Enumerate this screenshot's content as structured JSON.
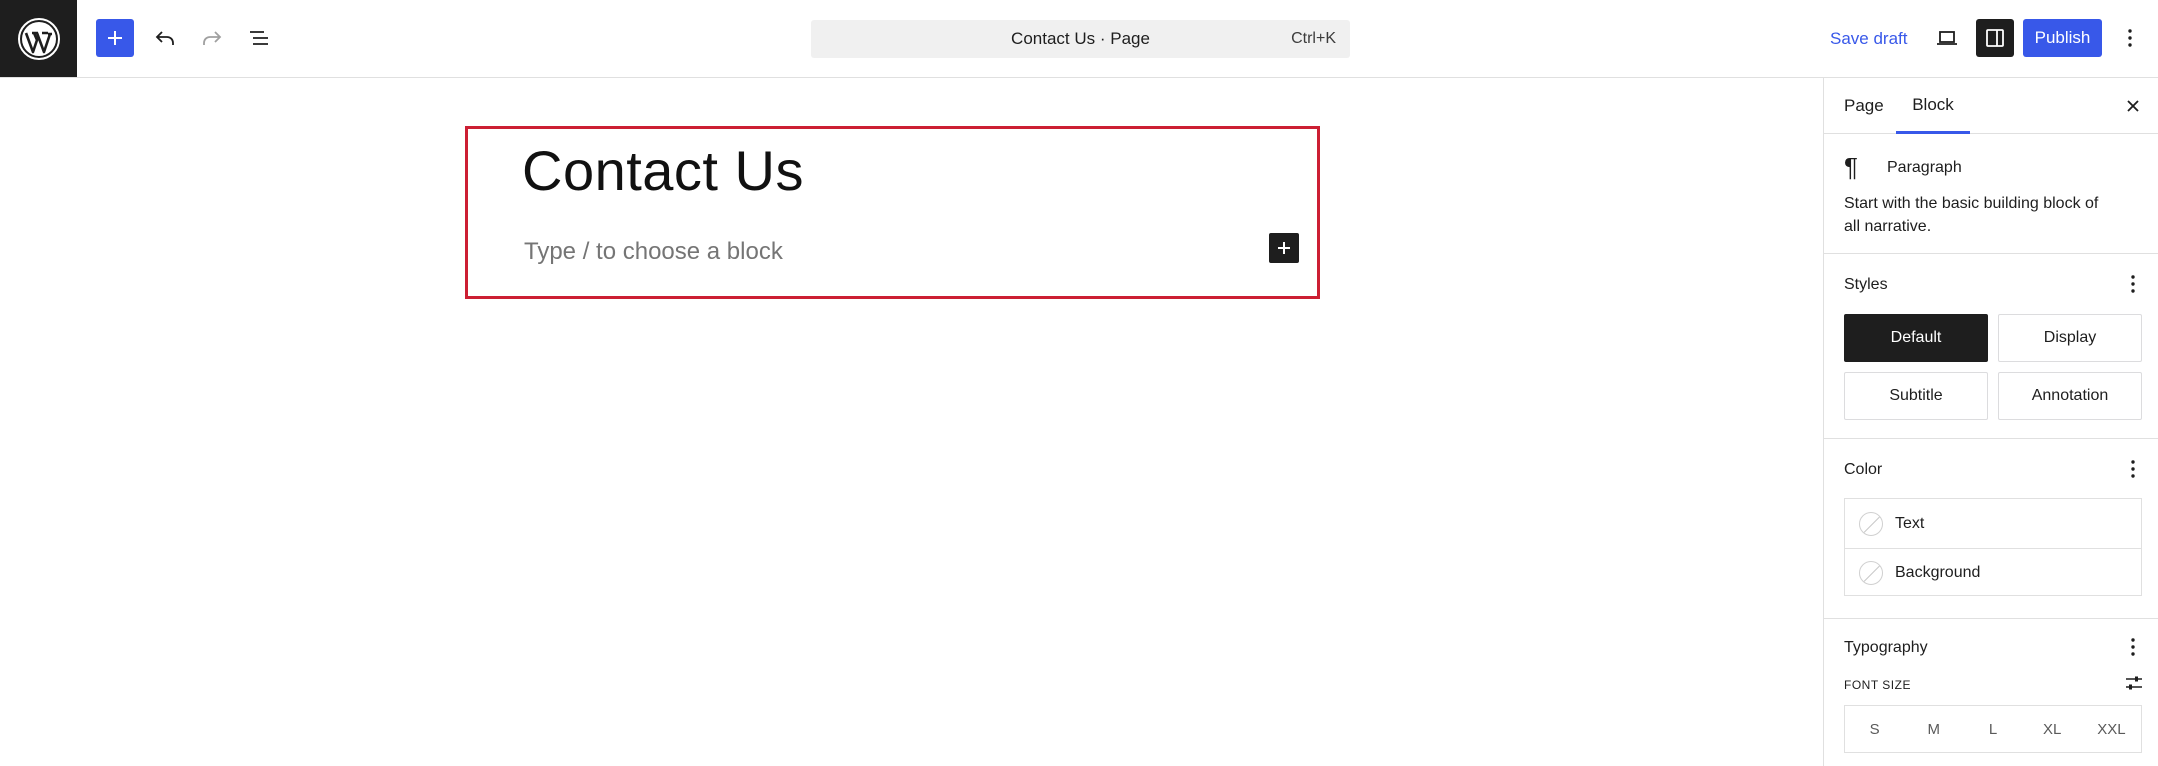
{
  "toolbar": {
    "document_title": "Contact Us · Page",
    "shortcut": "Ctrl+K",
    "save_draft": "Save draft",
    "publish": "Publish"
  },
  "editor": {
    "title": "Contact Us",
    "placeholder": "Type / to choose a block"
  },
  "sidebar": {
    "tabs": [
      "Page",
      "Block"
    ],
    "active_tab": "Block",
    "block": {
      "name": "Paragraph",
      "description": "Start with the basic building block of all narrative."
    },
    "styles": {
      "title": "Styles",
      "options": [
        "Default",
        "Display",
        "Subtitle",
        "Annotation"
      ],
      "selected": "Default"
    },
    "color": {
      "title": "Color",
      "items": [
        "Text",
        "Background"
      ]
    },
    "typography": {
      "title": "Typography",
      "font_size_label": "FONT SIZE",
      "sizes": [
        "S",
        "M",
        "L",
        "XL",
        "XXL"
      ]
    }
  },
  "colors": {
    "accent": "#3858e9",
    "selection_outline": "#cc1f33",
    "dark": "#1e1e1e"
  },
  "icons": {
    "logo": "wordpress-logo",
    "add": "plus-icon",
    "undo": "undo-icon",
    "redo": "redo-icon",
    "list_view": "list-view-icon",
    "preview": "laptop-icon",
    "settings": "sidebar-toggle-icon",
    "options": "vertical-dots-icon",
    "close": "close-icon",
    "paragraph": "pilcrow-icon",
    "font_size_settings": "sliders-icon"
  }
}
